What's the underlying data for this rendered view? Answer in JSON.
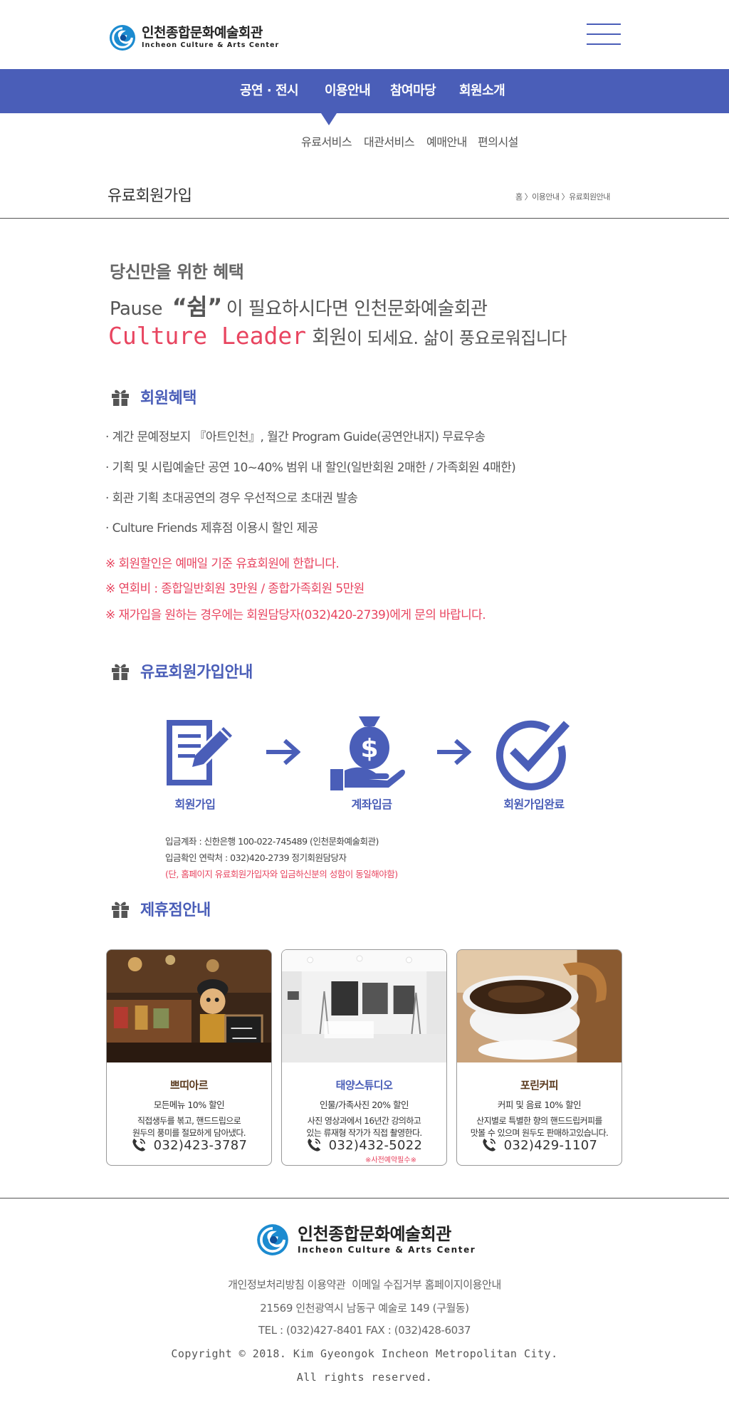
{
  "header": {
    "logo_kr": "인천종합문화예술회관",
    "logo_en": "Incheon Culture & Arts Center"
  },
  "gnb": [
    "공연 · 전시",
    "이용안내",
    "참여마당",
    "회원소개"
  ],
  "subnav": [
    "유료서비스",
    "대관서비스",
    "예매안내",
    "편의시설"
  ],
  "page": {
    "title": "유료회원가입",
    "breadcrumb": "홈 〉이용안내 〉유료회원안내"
  },
  "intro": {
    "line1": "당신만을 위한 혜택",
    "pause": "Pause",
    "rest": "“쉼”",
    "line2_rest": "이 필요하시다면 인천문화예술회관",
    "culture_leader": "Culture Leader",
    "member": "회원",
    "line3_rest": "이 되세요. 삶이 풍요로워집니다"
  },
  "benefits": {
    "title": "회원혜택",
    "items": [
      "· 계간 문예정보지 『아트인천』, 월간 Program Guide(공연안내지) 무료우송",
      "· 기획 및 시립예술단 공연 10~40% 범위 내 할인(일반회원 2매한 / 가족회원 4매한)",
      "· 회관 기획 초대공연의 경우 우선적으로 초대권 발송",
      "· Culture Friends 제휴점 이용시 할인 제공"
    ],
    "notices": [
      "※ 회원할인은 예매일 기준 유효회원에 한합니다.",
      "※ 연회비 : 종합일반회원 3만원 / 종합가족회원 5만원",
      "※ 재가입을 원하는 경우에는 회원담당자(032)420-2739)에게 문의 바랍니다."
    ]
  },
  "signup": {
    "title": "유료회원가입안내",
    "steps": [
      "회원가입",
      "계좌입금",
      "회원가입완료"
    ],
    "account_lines": [
      "입금계좌 : 신한은행 100-022-745489 (인천문화예술회관)",
      "입금확인 연락처 : 032)420-2739 정기회원담당자"
    ],
    "account_note": "(단, 홈페이지 유료회원가입자와 입금하신분의 성함이 동일해야함)"
  },
  "partners": {
    "title": "제휴점안내",
    "cards": [
      {
        "name": "쁘띠아르",
        "name_color": "#5a3a1e",
        "offer": "모든메뉴 10% 할인",
        "desc1": "직접생두를 볶고, 핸드드립으로",
        "desc2": "원두의 풍미를 절묘하게 담아냈다.",
        "phone": "032)423-3787",
        "note": ""
      },
      {
        "name": "태양스튜디오",
        "name_color": "#4a5eb8",
        "offer": "인물/가족사진 20% 할인",
        "desc1": "사진 영상과에서 16년간 강의하고",
        "desc2": "있는 류재형 작가가 직접 촬영한다.",
        "phone": "032)432-5022",
        "note": "※사전예약필수※"
      },
      {
        "name": "포린커피",
        "name_color": "#5a3a1e",
        "offer": "커피 및 음료 10% 할인",
        "desc1": "산지별로 특별한 향의 핸드드립커피를",
        "desc2": "맛볼 수 있으며 원두도 판매하고있습니다.",
        "phone": "032)429-1107",
        "note": ""
      }
    ]
  },
  "footer": {
    "logo_kr": "인천종합문화예술회관",
    "logo_en": "Incheon Culture & Arts Center",
    "links": [
      "개인정보처리방침",
      "이용약관",
      "이메일 수집거부",
      "홈페이지이용안내"
    ],
    "address": "21569 인천광역시 남동구 예술로 149 (구월동)",
    "tel": "TEL : (032)427-8401 FAX : (032)428-6037",
    "copyright": "Copyright © 2018. Kim Gyeongok Incheon Metropolitan City.",
    "rights": "All rights reserved."
  },
  "colors": {
    "brand": "#4a5eb8",
    "accent": "#e84560"
  },
  "icons": [
    "logo-swirl-icon",
    "hamburger-menu-icon",
    "gift-icon",
    "document-pen-icon",
    "money-bag-hand-icon",
    "check-circle-icon",
    "arrow-right-icon",
    "phone-icon"
  ]
}
